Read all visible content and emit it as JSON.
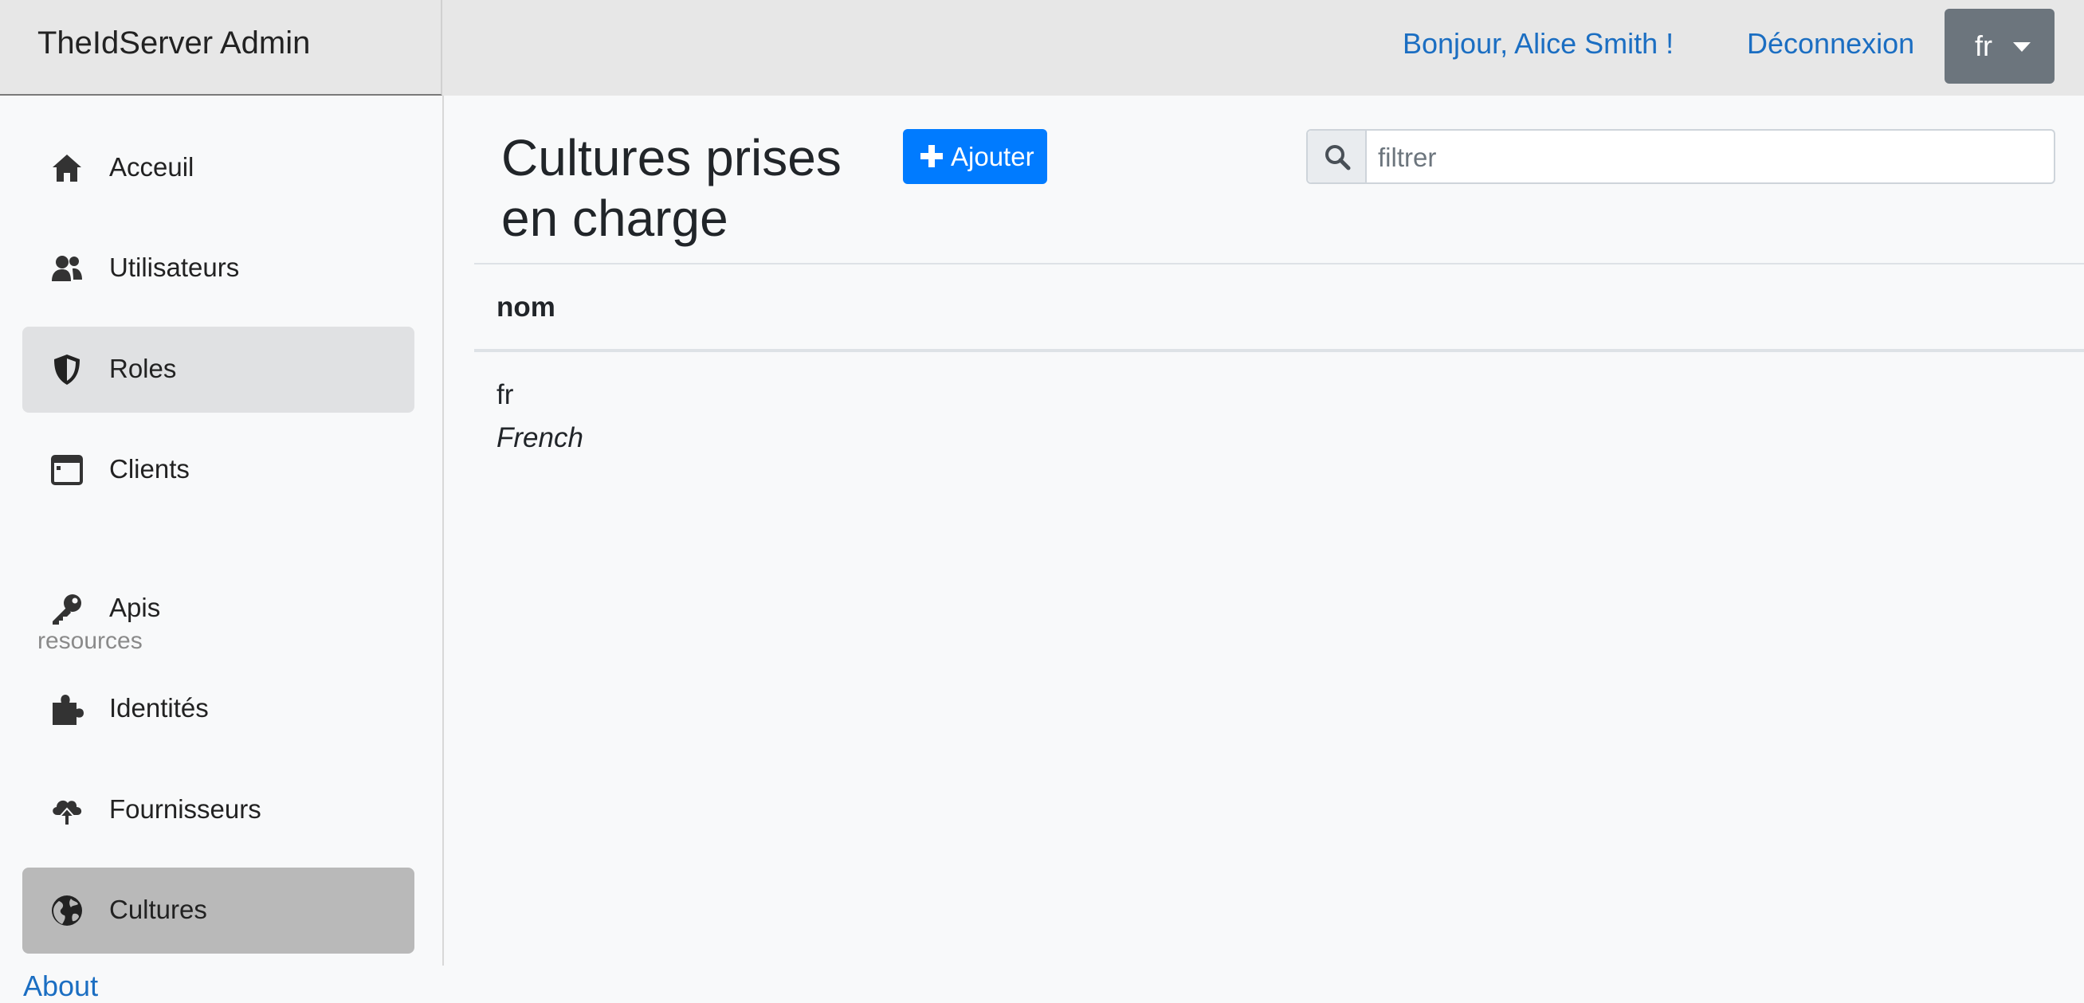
{
  "app": {
    "brand": "TheIdServer Admin"
  },
  "header": {
    "greeting": "Bonjour, Alice Smith !",
    "logout": "Déconnexion",
    "language": "fr"
  },
  "sidebar": {
    "items": [
      {
        "label": "Acceuil",
        "icon": "home-icon"
      },
      {
        "label": "Utilisateurs",
        "icon": "users-icon"
      },
      {
        "label": "Roles",
        "icon": "shield-icon"
      },
      {
        "label": "Clients",
        "icon": "window-icon"
      },
      {
        "label": "Apis",
        "icon": "key-icon"
      },
      {
        "label": "Identités",
        "icon": "puzzle-icon"
      },
      {
        "label": "Fournisseurs",
        "icon": "cloud-upload-icon"
      },
      {
        "label": "Cultures",
        "icon": "globe-icon"
      }
    ],
    "section_label": "resources",
    "about": "About"
  },
  "main": {
    "title": "Cultures prises en charge",
    "add_label": "Ajouter",
    "search_placeholder": "filtrer",
    "table": {
      "columns": [
        "nom"
      ],
      "rows": [
        {
          "code": "fr",
          "name": "French"
        }
      ]
    }
  }
}
